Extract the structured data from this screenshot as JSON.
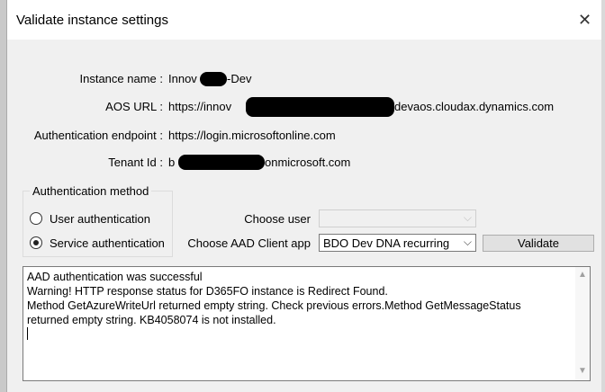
{
  "window": {
    "title": "Validate instance settings",
    "close_glyph": "✕"
  },
  "fields": {
    "instance_name": {
      "label": "Instance name :",
      "value_prefix": "Innov",
      "value_suffix": "-Dev"
    },
    "aos_url": {
      "label": "AOS URL :",
      "value_prefix": "https://innov",
      "value_suffix": "devaos.cloudax.dynamics.com"
    },
    "auth_endpoint": {
      "label": "Authentication endpoint :",
      "value": "https://login.microsoftonline.com"
    },
    "tenant_id": {
      "label": "Tenant Id :",
      "value_prefix": "b",
      "value_suffix": "onmicrosoft.com"
    }
  },
  "auth_method": {
    "legend": "Authentication method",
    "user_label": "User authentication",
    "service_label": "Service authentication",
    "selected": "service"
  },
  "choose_user": {
    "label": "Choose user",
    "value": "",
    "enabled": false
  },
  "choose_aad_app": {
    "label": "Choose AAD Client app",
    "value": "BDO Dev DNA recurring"
  },
  "validate_button": {
    "label": "Validate"
  },
  "log": {
    "lines": [
      "AAD authentication was successful",
      "Warning! HTTP response status for D365FO instance is Redirect Found.",
      "Method GetAzureWriteUrl returned empty string. Check previous errors.Method GetMessageStatus",
      "returned empty string. KB4058074 is not installed."
    ]
  },
  "icons": {
    "radio": "radio-button",
    "dropdown": "chevron-down-icon",
    "close": "close-icon"
  }
}
